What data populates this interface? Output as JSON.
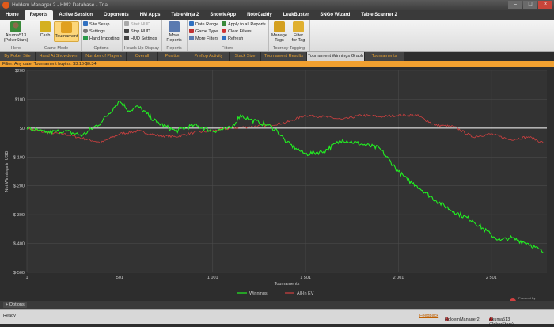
{
  "window": {
    "title": "Holdem Manager 2 - HM2 Database - Trial"
  },
  "menu": {
    "items": [
      "Home",
      "Reports",
      "Active Session",
      "Opponents",
      "HM Apps",
      "TableNinja 2",
      "SnowieApp",
      "NoteCaddy",
      "LeakBuster",
      "SNGo Wizard",
      "Table Scanner 2"
    ],
    "active_index": 1
  },
  "ribbon": {
    "hero": {
      "name": "Akuma513",
      "site": "(PokerStars)",
      "group": "Hero"
    },
    "game_mode": {
      "cash": "Cash",
      "tournament": "Tournament",
      "group": "Game Mode"
    },
    "options": {
      "site_setup": "Site Setup",
      "settings": "Settings",
      "hand_importing": "Hand Importing",
      "group": "Options"
    },
    "hud": {
      "start": "Start HUD",
      "stop": "Stop HUD",
      "hud_settings": "HUD Settings",
      "group": "Heads-Up Display"
    },
    "reports": {
      "more_reports": "More",
      "more_reports2": "Reports",
      "group": "Reports"
    },
    "filters": {
      "date_range": "Date Range",
      "game_type": "Game Type",
      "more_filters": "More Filters",
      "apply_all": "Apply to all Reports",
      "clear": "Clear Filters",
      "refresh": "Refresh",
      "group": "Filters"
    },
    "tags": {
      "manage": "Manage",
      "manage2": "Tags",
      "filter": "Filter",
      "filter2": "for Tag",
      "group": "Tourney Tagging"
    }
  },
  "tabs": {
    "items": [
      "By Poker Site",
      "Hand At Showdown",
      "Number of Players",
      "Overall",
      "Position",
      "Preflop Activity",
      "Stack Size",
      "Tournament Results",
      "Tournament Winnings Graph",
      "Tournaments"
    ],
    "active_index": 8
  },
  "filter_text": "Filter: Any date; Tournament buyins: $3.16-$0.34",
  "options_label": "Options",
  "status": {
    "ready": "Ready",
    "feedback": "Feedback",
    "app": "HoldemManager2",
    "player": "Akuma513 (PokerStars)"
  },
  "watermark": {
    "line1": "Powered By",
    "line2": "Holdem Manager"
  },
  "colors": {
    "winnings": "#22ee22",
    "allin_ev": "#d04040",
    "zero": "#ffffff",
    "accent": "#f0a030"
  },
  "chart_data": {
    "type": "line",
    "xlabel": "Tournaments",
    "ylabel": "Net Winnings in USD",
    "xlim": [
      1,
      2800
    ],
    "ylim": [
      -500,
      200
    ],
    "xticks": [
      1,
      501,
      1001,
      1501,
      2001,
      2501
    ],
    "xtick_labels": [
      "1",
      "501",
      "1 001",
      "1 501",
      "2 001",
      "2 501"
    ],
    "yticks": [
      200,
      100,
      0,
      -100,
      -200,
      -300,
      -400,
      -500
    ],
    "ytick_labels": [
      "$200",
      "$100",
      "$0",
      "$-100",
      "$-200",
      "$-300",
      "$-400",
      "$-500"
    ],
    "grid": true,
    "legend_position": "bottom",
    "series": [
      {
        "name": "Winnings",
        "x": [
          1,
          100,
          200,
          300,
          400,
          480,
          500,
          550,
          600,
          700,
          800,
          900,
          1000,
          1100,
          1150,
          1200,
          1250,
          1300,
          1350,
          1400,
          1450,
          1500,
          1600,
          1700,
          1800,
          1900,
          2000,
          2050,
          2100,
          2200,
          2300,
          2400,
          2500,
          2550,
          2600,
          2700,
          2780
        ],
        "y": [
          0,
          -15,
          -10,
          -25,
          20,
          80,
          95,
          60,
          75,
          20,
          -10,
          10,
          -10,
          0,
          45,
          30,
          20,
          10,
          -10,
          -50,
          -70,
          -90,
          -80,
          -40,
          -55,
          -70,
          -150,
          -180,
          -200,
          -250,
          -290,
          -320,
          -370,
          -390,
          -380,
          -400,
          -430
        ]
      },
      {
        "name": "All-In EV",
        "x": [
          1,
          100,
          200,
          300,
          400,
          500,
          600,
          700,
          800,
          900,
          1000,
          1100,
          1200,
          1300,
          1400,
          1500,
          1600,
          1700,
          1800,
          1900,
          2000,
          2100,
          2200,
          2300,
          2400,
          2500,
          2600,
          2700,
          2780
        ],
        "y": [
          0,
          -15,
          -20,
          -35,
          -50,
          -20,
          -10,
          -25,
          -30,
          -15,
          -10,
          0,
          5,
          10,
          20,
          45,
          40,
          30,
          45,
          40,
          45,
          45,
          10,
          5,
          -30,
          -20,
          -40,
          -30,
          -50
        ]
      }
    ]
  }
}
